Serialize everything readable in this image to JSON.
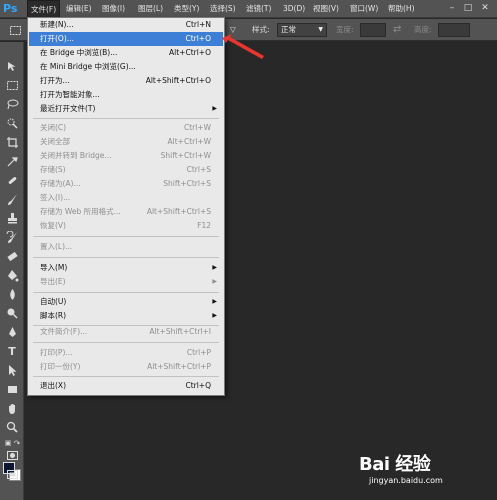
{
  "app": {
    "logo": "Ps"
  },
  "menubar": {
    "items": [
      "文件(F)",
      "编辑(E)",
      "图像(I)",
      "图层(L)",
      "类型(Y)",
      "选择(S)",
      "滤镜(T)",
      "3D(D)",
      "视图(V)",
      "窗口(W)",
      "帮助(H)"
    ]
  },
  "optionsbar": {
    "style_label": "样式:",
    "style_value": "正常",
    "width_label": "宽度:",
    "height_label": "高度:"
  },
  "file_menu": {
    "items": [
      {
        "label": "新建(N)...",
        "shortcut": "Ctrl+N",
        "enabled": true
      },
      {
        "label": "打开(O)...",
        "shortcut": "Ctrl+O",
        "enabled": true,
        "highlighted": true
      },
      {
        "label": "在 Bridge 中浏览(B)...",
        "shortcut": "Alt+Ctrl+O",
        "enabled": true
      },
      {
        "label": "在 Mini Bridge 中浏览(G)...",
        "shortcut": "",
        "enabled": true
      },
      {
        "label": "打开为...",
        "shortcut": "Alt+Shift+Ctrl+O",
        "enabled": true
      },
      {
        "label": "打开为智能对象...",
        "shortcut": "",
        "enabled": true
      },
      {
        "label": "最近打开文件(T)",
        "shortcut": "",
        "enabled": true,
        "submenu": true
      },
      {
        "separator": true
      },
      {
        "label": "关闭(C)",
        "shortcut": "Ctrl+W",
        "enabled": false
      },
      {
        "label": "关闭全部",
        "shortcut": "Alt+Ctrl+W",
        "enabled": false
      },
      {
        "label": "关闭并转到 Bridge...",
        "shortcut": "Shift+Ctrl+W",
        "enabled": false
      },
      {
        "label": "存储(S)",
        "shortcut": "Ctrl+S",
        "enabled": false
      },
      {
        "label": "存储为(A)...",
        "shortcut": "Shift+Ctrl+S",
        "enabled": false
      },
      {
        "label": "签入(I)...",
        "shortcut": "",
        "enabled": false
      },
      {
        "label": "存储为 Web 所用格式...",
        "shortcut": "Alt+Shift+Ctrl+S",
        "enabled": false
      },
      {
        "label": "恢复(V)",
        "shortcut": "F12",
        "enabled": false
      },
      {
        "separator": true
      },
      {
        "label": "置入(L)...",
        "shortcut": "",
        "enabled": false
      },
      {
        "separator": true
      },
      {
        "label": "导入(M)",
        "shortcut": "",
        "enabled": true,
        "submenu": true
      },
      {
        "label": "导出(E)",
        "shortcut": "",
        "enabled": false,
        "submenu": true
      },
      {
        "separator": true
      },
      {
        "label": "自动(U)",
        "shortcut": "",
        "enabled": true,
        "submenu": true
      },
      {
        "label": "脚本(R)",
        "shortcut": "",
        "enabled": true,
        "submenu": true
      },
      {
        "separator": true
      },
      {
        "label": "文件简介(F)...",
        "shortcut": "Alt+Shift+Ctrl+I",
        "enabled": false
      },
      {
        "separator": true
      },
      {
        "label": "打印(P)...",
        "shortcut": "Ctrl+P",
        "enabled": false
      },
      {
        "label": "打印一份(Y)",
        "shortcut": "Alt+Shift+Ctrl+P",
        "enabled": false
      },
      {
        "separator": true
      },
      {
        "label": "退出(X)",
        "shortcut": "Ctrl+Q",
        "enabled": true
      }
    ]
  },
  "watermark": {
    "logo_text": "Bai 经验",
    "url": "jingyan.baidu.com"
  },
  "colors": {
    "foreground": "#0b1631",
    "background": "#ffffff",
    "highlight": "#3d7fd6",
    "callout": "#e8362f"
  },
  "toolbar": {
    "tools": [
      "move-icon",
      "marquee-icon",
      "lasso-icon",
      "quick-select-icon",
      "crop-icon",
      "eyedropper-icon",
      "healing-icon",
      "brush-icon",
      "stamp-icon",
      "history-brush-icon",
      "eraser-icon",
      "gradient-icon",
      "blur-icon",
      "dodge-icon",
      "pen-icon",
      "type-icon",
      "path-select-icon",
      "rectangle-icon",
      "hand-icon",
      "zoom-icon"
    ]
  }
}
